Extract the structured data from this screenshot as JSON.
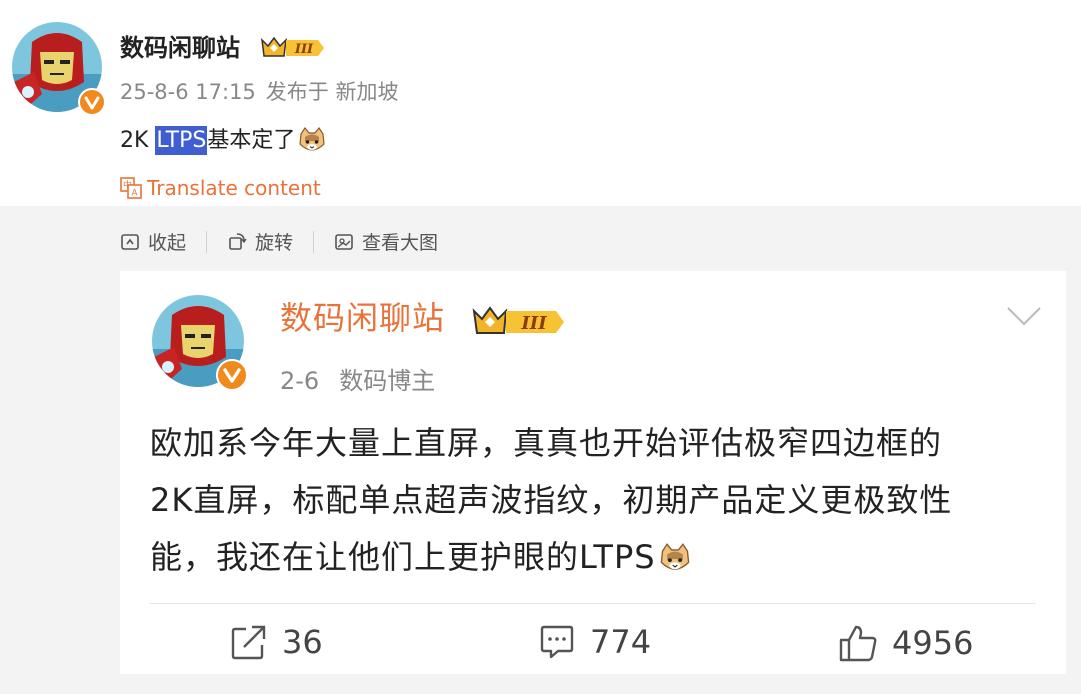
{
  "post": {
    "author": "数码闲聊站",
    "date": "25-8-6 17:15",
    "location": "发布于 新加坡",
    "text_prefix": "2K ",
    "text_highlight": "LTPS",
    "text_suffix": "基本定了",
    "translate_label": "Translate content"
  },
  "toolbar": {
    "collapse_label": "收起",
    "rotate_label": "旋转",
    "view_large_label": "查看大图"
  },
  "card": {
    "author": "数码闲聊站",
    "date": "2-6",
    "role": "数码博主",
    "body_lines": [
      "欧加系今年大量上直屏，真真也开始评估极窄四边框的",
      "2K直屏，标配单点超声波指纹，初期产品定义更极致性",
      "能，我还在让他们上更护眼的LTPS"
    ],
    "reposts": "36",
    "comments": "774",
    "likes": "4956"
  },
  "colors": {
    "accent_orange": "#e8733a",
    "highlight_blue": "#3f5ed1",
    "verified_badge": "#f08a1c",
    "page_grey": "#f3f3f3"
  },
  "icons": [
    "avatar-ironman",
    "verified-badge-icon",
    "vip-crown-icon",
    "cat-emoji-icon",
    "translate-icon",
    "collapse-icon",
    "rotate-icon",
    "view-large-icon",
    "chevron-down-icon",
    "repost-icon",
    "comment-icon",
    "like-icon"
  ]
}
